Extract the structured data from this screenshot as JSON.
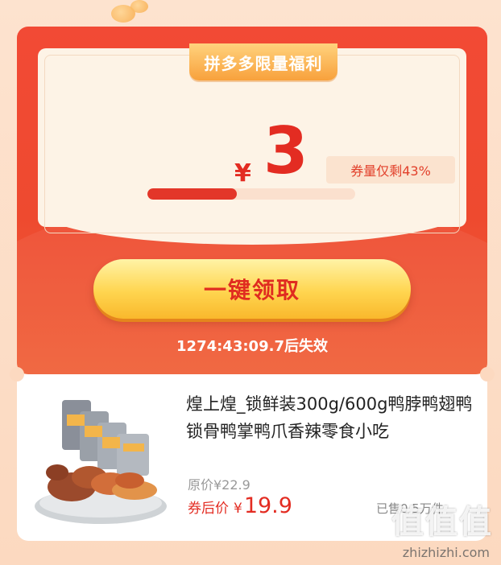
{
  "coupon": {
    "tag": "拼多多限量福利",
    "currency": "¥",
    "amount": "3",
    "remaining_text": "券量仅剩43%",
    "remaining_percent": 43,
    "claim_label": "一键领取",
    "countdown": "1274:43:09.7后失效"
  },
  "product": {
    "title": "煌上煌_锁鲜装300g/600g鸭脖鸭翅鸭锁骨鸭掌鸭爪香辣零食小吃",
    "original_price": "原价¥22.9",
    "after_coupon_label": "券后价",
    "after_coupon_currency": "¥",
    "after_coupon_price": "19.9",
    "sold": "已售0.5万件"
  },
  "watermark": {
    "logo_text": "值值值",
    "site": "zhizhizhi.com"
  },
  "colors": {
    "accent_red": "#e32c22",
    "card_red": "#f24a35",
    "gold": "#ffd54f"
  }
}
